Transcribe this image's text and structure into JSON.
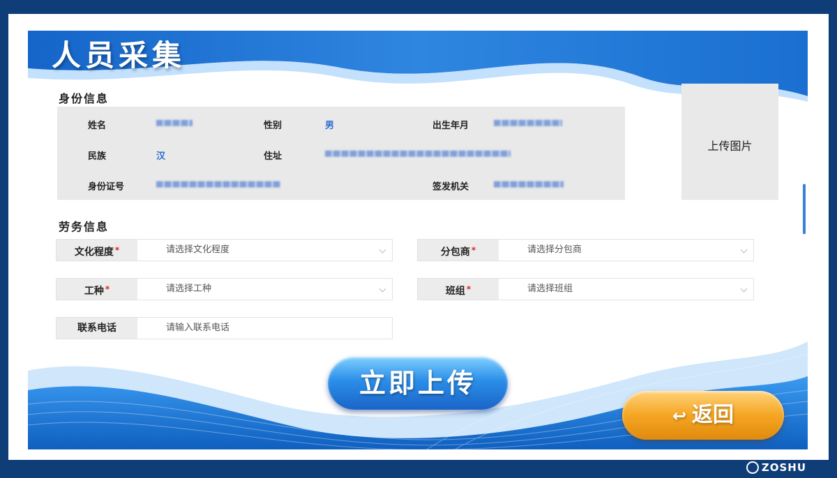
{
  "page": {
    "title": "人员采集"
  },
  "identity": {
    "section_title": "身份信息",
    "name_label": "姓名",
    "gender_label": "性别",
    "gender_value": "男",
    "birth_label": "出生年月",
    "ethnicity_label": "民族",
    "ethnicity_value": "汉",
    "address_label": "住址",
    "id_number_label": "身份证号",
    "issuer_label": "签发机关"
  },
  "upload_image": {
    "label": "上传图片"
  },
  "labor": {
    "section_title": "劳务信息",
    "fields": [
      {
        "label": "文化程度",
        "required": "*",
        "placeholder": "请选择文化程度"
      },
      {
        "label": "分包商",
        "required": "*",
        "placeholder": "请选择分包商"
      },
      {
        "label": "工种",
        "required": "*",
        "placeholder": "请选择工种"
      },
      {
        "label": "班组",
        "required": "*",
        "placeholder": "请选择班组"
      },
      {
        "label": "联系电话",
        "placeholder": "请输入联系电话"
      }
    ]
  },
  "buttons": {
    "upload_now": "立即上传",
    "back": "返回",
    "back_icon": "↩"
  },
  "watermark": {
    "text": "ZOSHU"
  },
  "colors": {
    "primary_blue": "#2b8ee8",
    "back_orange": "#f5a623",
    "value_blue": "#2e6fd1",
    "required_red": "#e0241b"
  }
}
